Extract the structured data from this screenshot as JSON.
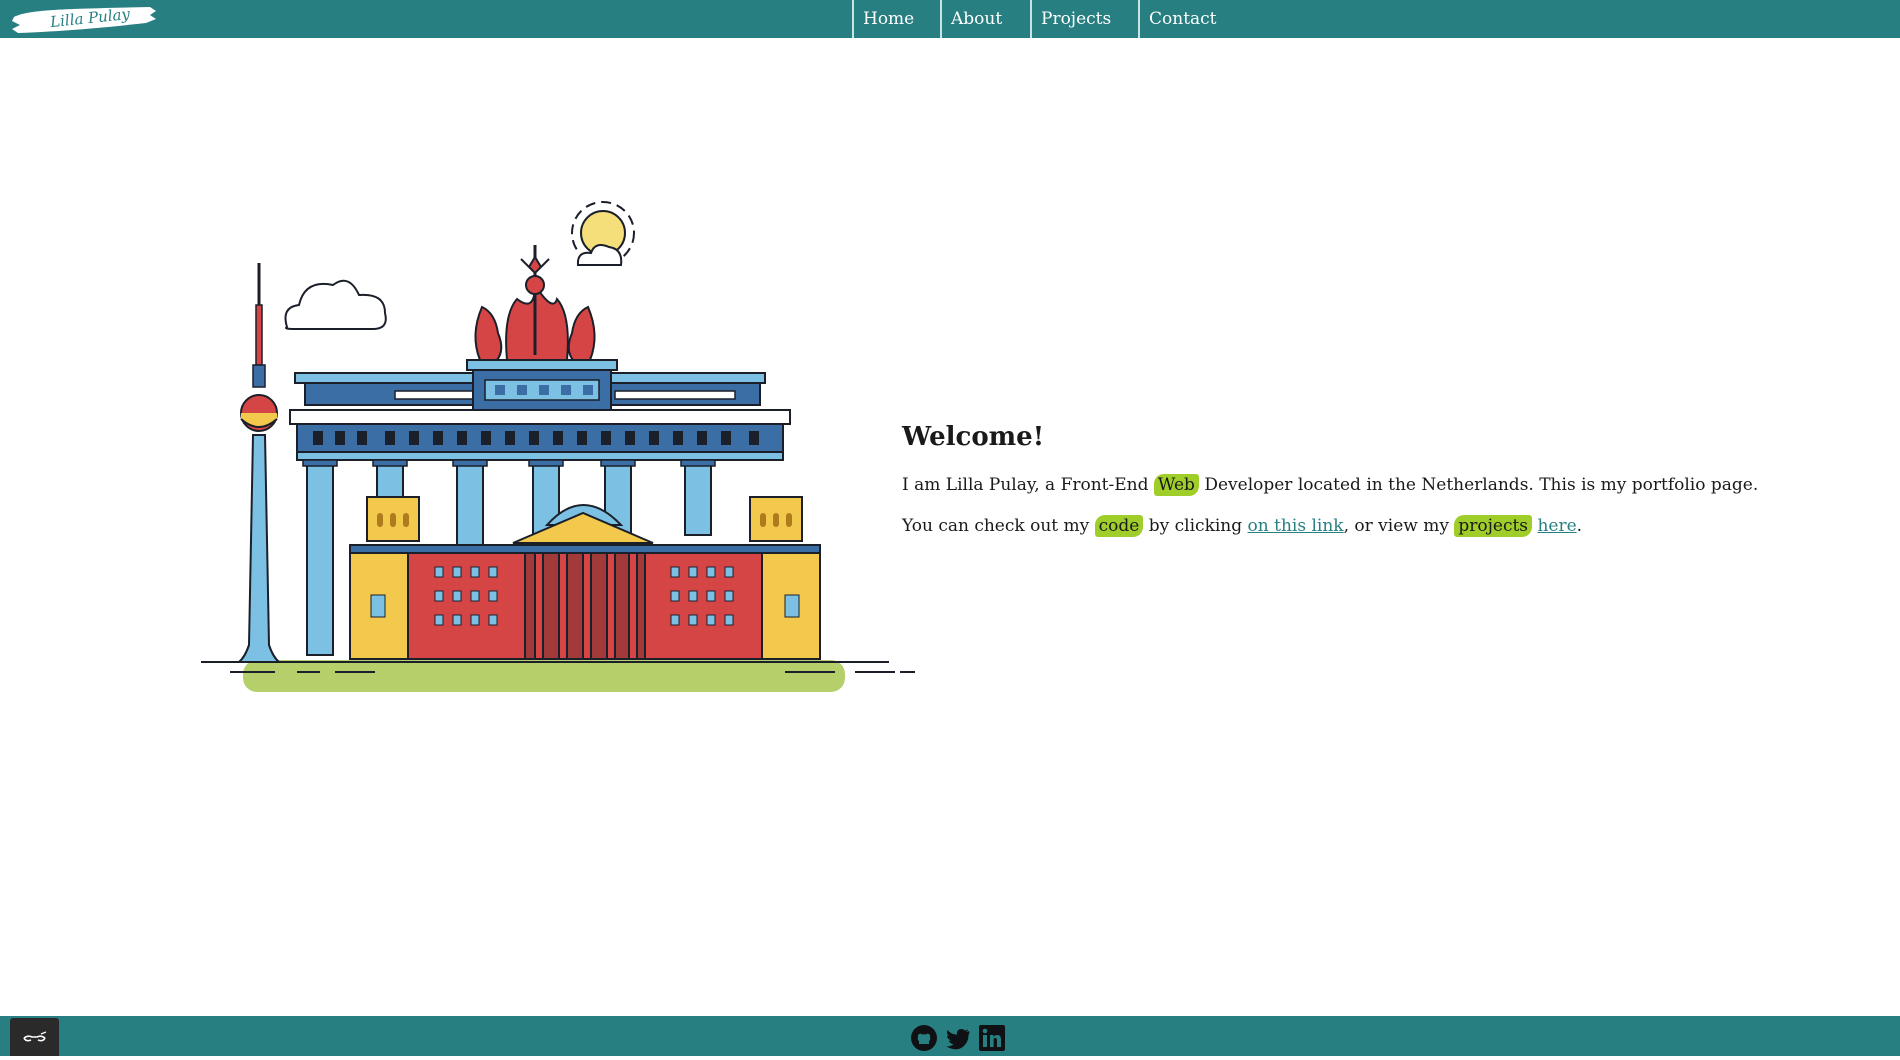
{
  "header": {
    "logo_text": "Lilla Pulay",
    "nav": [
      {
        "label": "Home"
      },
      {
        "label": "About"
      },
      {
        "label": "Projects"
      },
      {
        "label": "Contact"
      }
    ]
  },
  "main": {
    "title": "Welcome!",
    "intro": {
      "before": "I am Lilla Pulay, a Front-End ",
      "highlight": "Web",
      "after": " Developer located in the Netherlands. This is my portfolio page."
    },
    "links_line": {
      "part1": "You can check out my ",
      "highlight1": "code",
      "part2": " by clicking ",
      "link1": "on this link",
      "part3": ", or view my ",
      "highlight2": "projects",
      "part4": " ",
      "link2": "here",
      "part5": "."
    }
  },
  "footer": {
    "social": [
      "github-icon",
      "twitter-icon",
      "linkedin-icon"
    ]
  },
  "colors": {
    "brand": "#277f82",
    "highlight": "#9fcd2a",
    "toggle": "#2a2a2a"
  }
}
